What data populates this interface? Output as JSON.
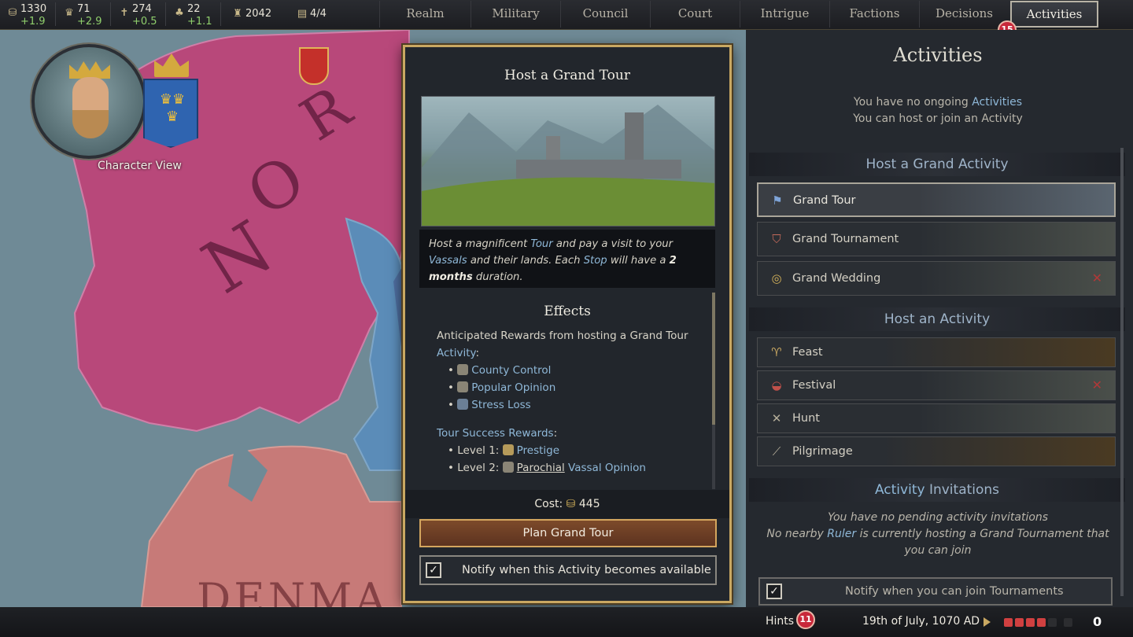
{
  "topbar": {
    "resources": [
      {
        "icon": "gold-icon",
        "value": "1330",
        "delta": "+1.9"
      },
      {
        "icon": "prestige-icon",
        "value": "71",
        "delta": "+2.9"
      },
      {
        "icon": "piety-icon",
        "value": "274",
        "delta": "+0.5"
      },
      {
        "icon": "renown-icon",
        "value": "22",
        "delta": "+1.1"
      }
    ],
    "soldiers": {
      "icon": "soldiers-icon",
      "value": "2042"
    },
    "domain": {
      "icon": "domain-icon",
      "value": "4/4"
    },
    "tabs": [
      "Realm",
      "Military",
      "Council",
      "Court",
      "Intrigue",
      "Factions",
      "Decisions",
      "Activities"
    ],
    "active_tab": "Activities",
    "activities_badge": "15"
  },
  "map": {
    "labels": [
      "N",
      "O",
      "R",
      "DENMA"
    ]
  },
  "character": {
    "label": "Character View"
  },
  "panel": {
    "title": "Host a Grand Tour",
    "desc": [
      {
        "t": "Host a magnificent "
      },
      {
        "t": "Tour",
        "c": "hl"
      },
      {
        "t": " and pay a visit to your "
      },
      {
        "t": "Vassals",
        "c": "hl"
      },
      {
        "t": " and their lands. Each "
      },
      {
        "t": "Stop",
        "c": "hl"
      },
      {
        "t": " will have a "
      },
      {
        "t": "2 months",
        "c": "bold"
      },
      {
        "t": " duration."
      }
    ],
    "effects_title": "Effects",
    "rewards_intro_a": "Anticipated Rewards from hosting a Grand Tour",
    "rewards_intro_b": "Activity",
    "rewards_intro_c": ":",
    "rewards": [
      "County Control",
      "Popular Opinion",
      "Stress Loss"
    ],
    "tour_success_label": "Tour Success Rewards",
    "tour_success_colon": ":",
    "level1_label": "Level 1:",
    "level1_reward": "Prestige",
    "level2_label": "Level 2:",
    "level2_reward_a": "Parochial",
    "level2_reward_b": "Vassal Opinion",
    "cost_label": "Cost:",
    "cost_value": "445",
    "plan_button": "Plan Grand Tour",
    "notify_label": "Notify when this Activity becomes available",
    "notify_checked": "✓"
  },
  "right": {
    "title": "Activities",
    "info_a1": "You have no ongoing ",
    "info_a2": "Activities",
    "info_b": "You can host or join an Activity",
    "grand_header": "Host a Grand Activity",
    "grand_items": [
      {
        "icon": "banner-icon",
        "label": "Grand Tour"
      },
      {
        "icon": "shield-tournament-icon",
        "label": "Grand Tournament"
      },
      {
        "icon": "rings-icon",
        "label": "Grand Wedding"
      }
    ],
    "host_header": "Host an Activity",
    "host_items": [
      {
        "icon": "goblet-icon",
        "label": "Feast"
      },
      {
        "icon": "festival-bowl-icon",
        "label": "Festival"
      },
      {
        "icon": "crossed-spears-icon",
        "label": "Hunt"
      },
      {
        "icon": "staff-icon",
        "label": "Pilgrimage"
      }
    ],
    "invites_header_a": "Activity",
    "invites_header_b": " Invitations",
    "invites_line1": "You have no pending activity invitations",
    "invites_line2a": "No nearby ",
    "invites_line2b": "Ruler",
    "invites_line2c": " is currently hosting a Grand Tournament that",
    "invites_line3": "you can join",
    "notify_label": "Notify when you can join Tournaments",
    "notify_checked": "✓"
  },
  "bottombar": {
    "hints_label": "Hints",
    "hints_badge": "11",
    "date": "19th of July, 1070 AD",
    "speed": "0"
  },
  "colors": {
    "map_pink": "#b8487a",
    "map_salmon": "#c77a78",
    "map_blue": "#6f8a96",
    "gold_border": "#c9a862",
    "link_blue": "#8fb8d8",
    "badge_red": "#c8283a"
  }
}
